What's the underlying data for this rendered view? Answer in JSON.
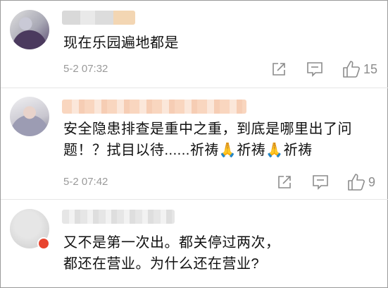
{
  "comments": [
    {
      "text": "现在乐园遍地都是",
      "time": "5-2 07:32",
      "likes": "15"
    },
    {
      "text_parts": [
        "安全隐患排查是重中之重，到底是哪里出了问题！？拭目以待......祈祷",
        "🙏",
        "祈祷",
        "🙏",
        "祈祷"
      ],
      "time": "5-2 07:42",
      "likes": "9"
    },
    {
      "text": "又不是第一次出。都关停过两次，都还在营业。为什么还在营业?"
    }
  ],
  "icons": {
    "share": "share-icon",
    "comment": "comment-icon",
    "like": "thumbs-up-icon",
    "badge": "verified-badge-icon"
  },
  "colors": {
    "meta_text": "#9a9a9a",
    "badge": "#e8442e"
  }
}
